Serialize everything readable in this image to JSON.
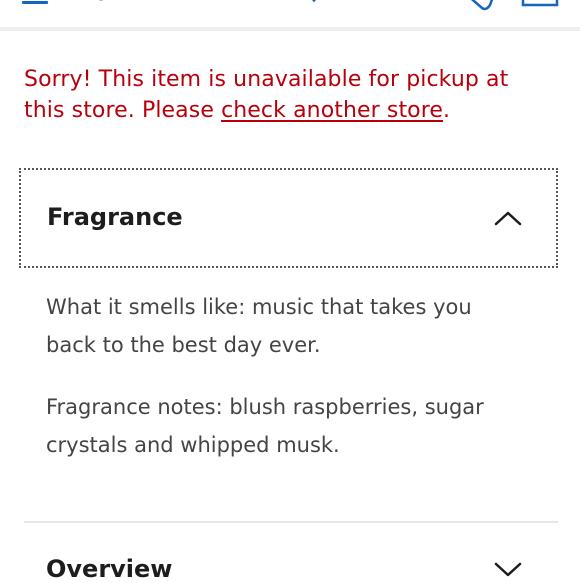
{
  "error": {
    "prefix": "Sorry! This item is unavailable for pickup at this store. Please ",
    "link": "check another store",
    "suffix": "."
  },
  "accordions": {
    "fragrance": {
      "title": "Fragrance",
      "expanded": true,
      "paragraphs": [
        "What it smells like: music that takes you back to the best day ever.",
        "Fragrance notes: blush raspberries, sugar crystals and whipped musk."
      ]
    },
    "overview": {
      "title": "Overview",
      "expanded": false
    }
  },
  "icons": {
    "menu": "menu-icon",
    "location": "location-pin-icon",
    "heart": "heart-icon",
    "cart": "shopping-bag-icon",
    "expanded": "chevron-up-icon",
    "collapsed": "chevron-down-icon"
  },
  "colors": {
    "error": "#b8000c",
    "accent": "#1565c0",
    "heading": "#1d1d1d",
    "body": "#444444"
  }
}
